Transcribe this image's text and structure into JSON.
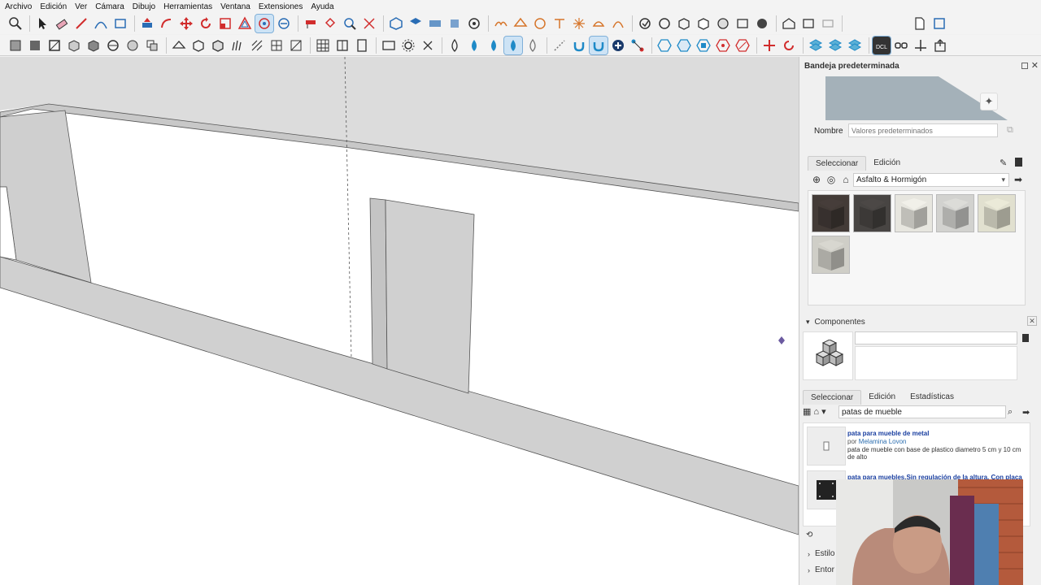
{
  "menu": [
    "Archivo",
    "Edición",
    "Ver",
    "Cámara",
    "Dibujo",
    "Herramientas",
    "Ventana",
    "Extensiones",
    "Ayuda"
  ],
  "tray": {
    "title": "Bandeja predeterminada",
    "materials": {
      "name_label": "Nombre",
      "name_placeholder": "Valores predeterminados",
      "tabs": [
        "Seleccionar",
        "Edición"
      ],
      "category": "Asfalto & Hormigón",
      "swatch_colors": [
        "#3a3330",
        "#3f3c3a",
        "#c9c8c2",
        "#b7b7b4",
        "#c4c3b4",
        "#b4b3ad"
      ]
    },
    "components": {
      "title": "Componentes",
      "tabs": [
        "Seleccionar",
        "Edición",
        "Estadísticas"
      ],
      "search_value": "patas de mueble",
      "results": [
        {
          "title": "pata para mueble de metal",
          "by_prefix": "por",
          "author": "Melamina Lovon",
          "description": "pata de mueble con base de plastico diametro 5 cm y 10 cm de alto"
        },
        {
          "title": "pata para muebles.Sin regulación de la altura. Con placa"
        }
      ]
    },
    "collapsed": [
      "Estilo",
      "Entor"
    ]
  },
  "colors": {
    "accent_active": "#cde3f5",
    "wall_fill": "#d0d0d0",
    "sky_fill": "#dcdcdc",
    "link_blue": "#1a3fa0"
  }
}
